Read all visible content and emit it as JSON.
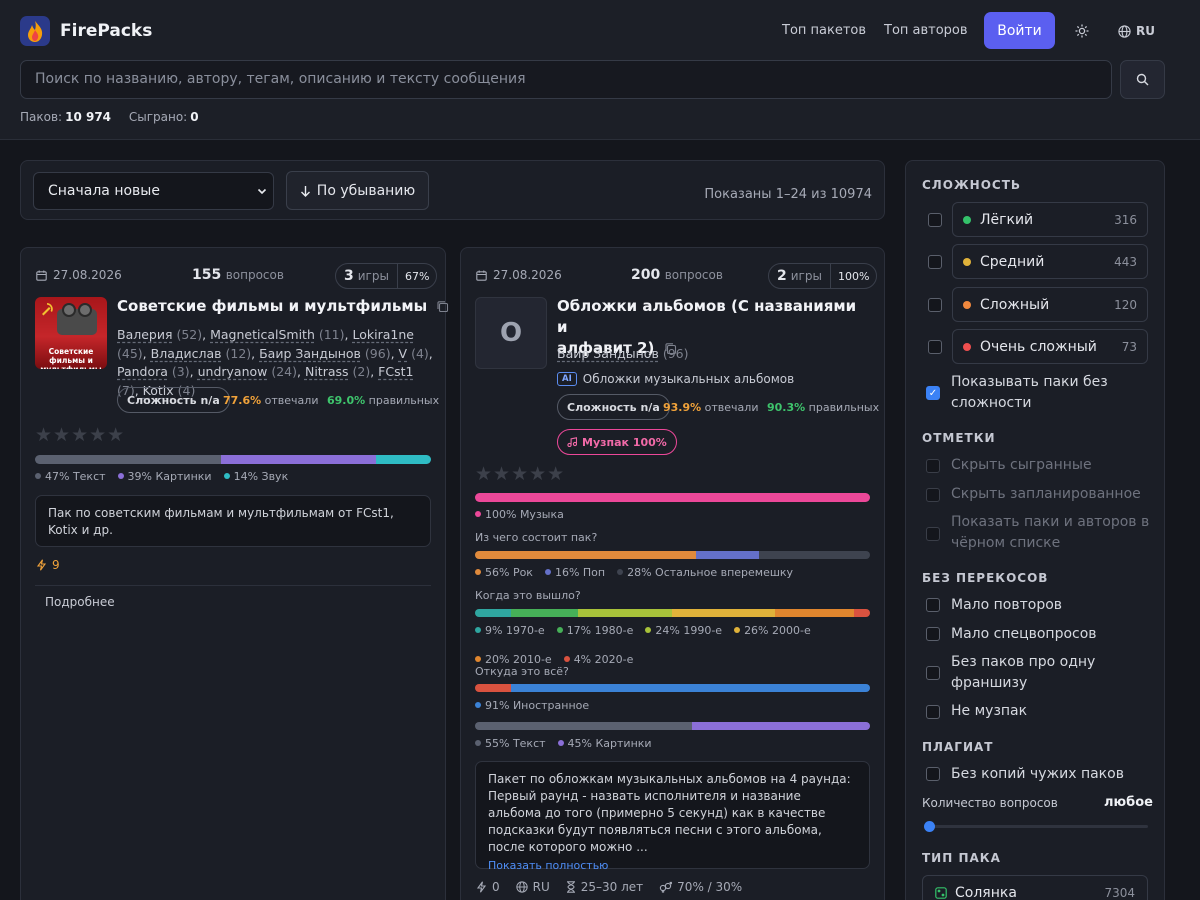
{
  "header": {
    "brand": "FirePacks",
    "nav": [
      "Топ пакетов",
      "Топ авторов"
    ],
    "login": "Войти",
    "lang": "RU",
    "search_placeholder": "Поиск по названию, автору, тегам, описанию и тексту сообщения",
    "stats": {
      "packs_label": "Паков:",
      "packs_value": "10 974",
      "played_label": "Сыграно:",
      "played_value": "0"
    }
  },
  "toolbar": {
    "sort_select": "Сначала новые",
    "order_button": "По убыванию",
    "shown": "Показаны 1–24 из 10974"
  },
  "cards": [
    {
      "date": "27.08.2026",
      "questions_count": "155",
      "questions_label": "вопросов",
      "games_count": "3",
      "games_label": "игры",
      "games_pct": "67%",
      "thumb_text": "Советские фильмы и мультфильмы",
      "title": "Советские фильмы и мультфильмы",
      "authors": [
        {
          "name": "Валерия",
          "count": "(52)"
        },
        {
          "name": "MagneticalSmith",
          "count": "(11)"
        },
        {
          "name": "Lokira1ne",
          "count": "(45)"
        },
        {
          "name": "Владислав",
          "count": "(12)"
        },
        {
          "name": "Баир Зандынов",
          "count": "(96)"
        },
        {
          "name": "V",
          "count": "(4)"
        },
        {
          "name": "Pandora",
          "count": "(3)"
        },
        {
          "name": "undryanow",
          "count": "(24)"
        },
        {
          "name": "Nitrass",
          "count": "(2)"
        },
        {
          "name": "FCst1",
          "count": "(7)"
        },
        {
          "name": "Kotix",
          "count": "(4)"
        }
      ],
      "difficulty": "Сложность n/a",
      "answered_pct": "77.6%",
      "answered_label": "отвечали",
      "correct_pct": "69.0%",
      "correct_label": "правильных",
      "stars": "★★★★★",
      "content_bar": [
        {
          "label": "47% Текст",
          "value": 47,
          "color": "#5b6170"
        },
        {
          "label": "39% Картинки",
          "value": 39,
          "color": "#8b6fd8"
        },
        {
          "label": "14% Звук",
          "value": 14,
          "color": "#2fbcc4"
        }
      ],
      "description": "Пак по советским фильмам и мультфильмам от FCst1, Kotix и др.",
      "likes": "9",
      "more": "Подробнее"
    },
    {
      "date": "27.08.2026",
      "questions_count": "200",
      "questions_label": "вопросов",
      "games_count": "2",
      "games_label": "игры",
      "games_pct": "100%",
      "thumb_letter": "О",
      "title_line1": "Обложки альбомов (С названиями и",
      "title_line2": "алфавит 2)",
      "author": "Баир Зандынов",
      "author_count": "(96)",
      "ai_badge": "AI",
      "ai_text": "Обложки музыкальных альбомов",
      "difficulty": "Сложность n/a",
      "answered_pct": "93.9%",
      "answered_label": "отвечали",
      "correct_pct": "90.3%",
      "correct_label": "правильных",
      "music_badge": "Музпак 100%",
      "stars": "★★★★★",
      "music_bar": [
        {
          "label": "100% Музыка",
          "value": 100,
          "color": "#ec4899"
        }
      ],
      "q1": "Из чего состоит пак?",
      "genre_bar": [
        {
          "label": "56% Рок",
          "value": 56,
          "color": "#e08a3c"
        },
        {
          "label": "16% Поп",
          "value": 16,
          "color": "#6470c8"
        },
        {
          "label": "28% Остальное вперемешку",
          "value": 28,
          "color": "#3e434f"
        }
      ],
      "q2": "Когда это вышло?",
      "era_bar": [
        {
          "label": "9% 1970-е",
          "value": 9,
          "color": "#2fa6a0"
        },
        {
          "label": "17% 1980-е",
          "value": 17,
          "color": "#46b058"
        },
        {
          "label": "24% 1990-е",
          "value": 24,
          "color": "#a8c23a"
        },
        {
          "label": "26% 2000-е",
          "value": 26,
          "color": "#e0b23a"
        },
        {
          "label": "20% 2010-е",
          "value": 20,
          "color": "#e0862e"
        },
        {
          "label": "4% 2020-е",
          "value": 4,
          "color": "#d9523f"
        }
      ],
      "q3": "Откуда это всё?",
      "origin_bar": [
        {
          "label": "",
          "value": 9,
          "color": "#d9523f"
        },
        {
          "label": "91% Иностранное",
          "value": 91,
          "color": "#3b82d6"
        }
      ],
      "content_bar": [
        {
          "label": "55% Текст",
          "value": 55,
          "color": "#5b6170"
        },
        {
          "label": "45% Картинки",
          "value": 45,
          "color": "#8b6fd8"
        }
      ],
      "description": "Пакет по обложкам музыкальных альбомов на 4 раунда: Первый раунд - назвать исполнителя и название альбома до того (примерно 5 секунд) как в качестве подсказки будут появляться песни с этого альбома, после которого можно ...",
      "show_full": "Показать полностью",
      "footer": {
        "likes": "0",
        "lang": "RU",
        "age": "25–30 лет",
        "gender": "70% / 30%"
      }
    }
  ],
  "sidebar": {
    "difficulty_title": "СЛОЖНОСТЬ",
    "difficulty": [
      {
        "label": "Лёгкий",
        "count": "316",
        "color": "#34c26a"
      },
      {
        "label": "Средний",
        "count": "443",
        "color": "#e0b23a"
      },
      {
        "label": "Сложный",
        "count": "120",
        "color": "#f0883e"
      },
      {
        "label": "Очень сложный",
        "count": "73",
        "color": "#ef4f4f"
      }
    ],
    "no_difficulty": "Показывать паки без сложности",
    "marks_title": "ОТМЕТКИ",
    "marks": [
      "Скрыть сыгранные",
      "Скрыть запланированное",
      "Показать паки и авторов в чёрном списке"
    ],
    "bias_title": "БЕЗ ПЕРЕКОСОВ",
    "bias": [
      "Мало повторов",
      "Мало спецвопросов",
      "Без паков про одну франшизу",
      "Не музпак"
    ],
    "plagiat_title": "ПЛАГИАТ",
    "plagiat": "Без копий чужих паков",
    "qcount_label": "Количество вопросов",
    "qcount_value": "любое",
    "type_title": "ТИП ПАКА",
    "type_item": "Солянка",
    "type_count": "7304"
  }
}
